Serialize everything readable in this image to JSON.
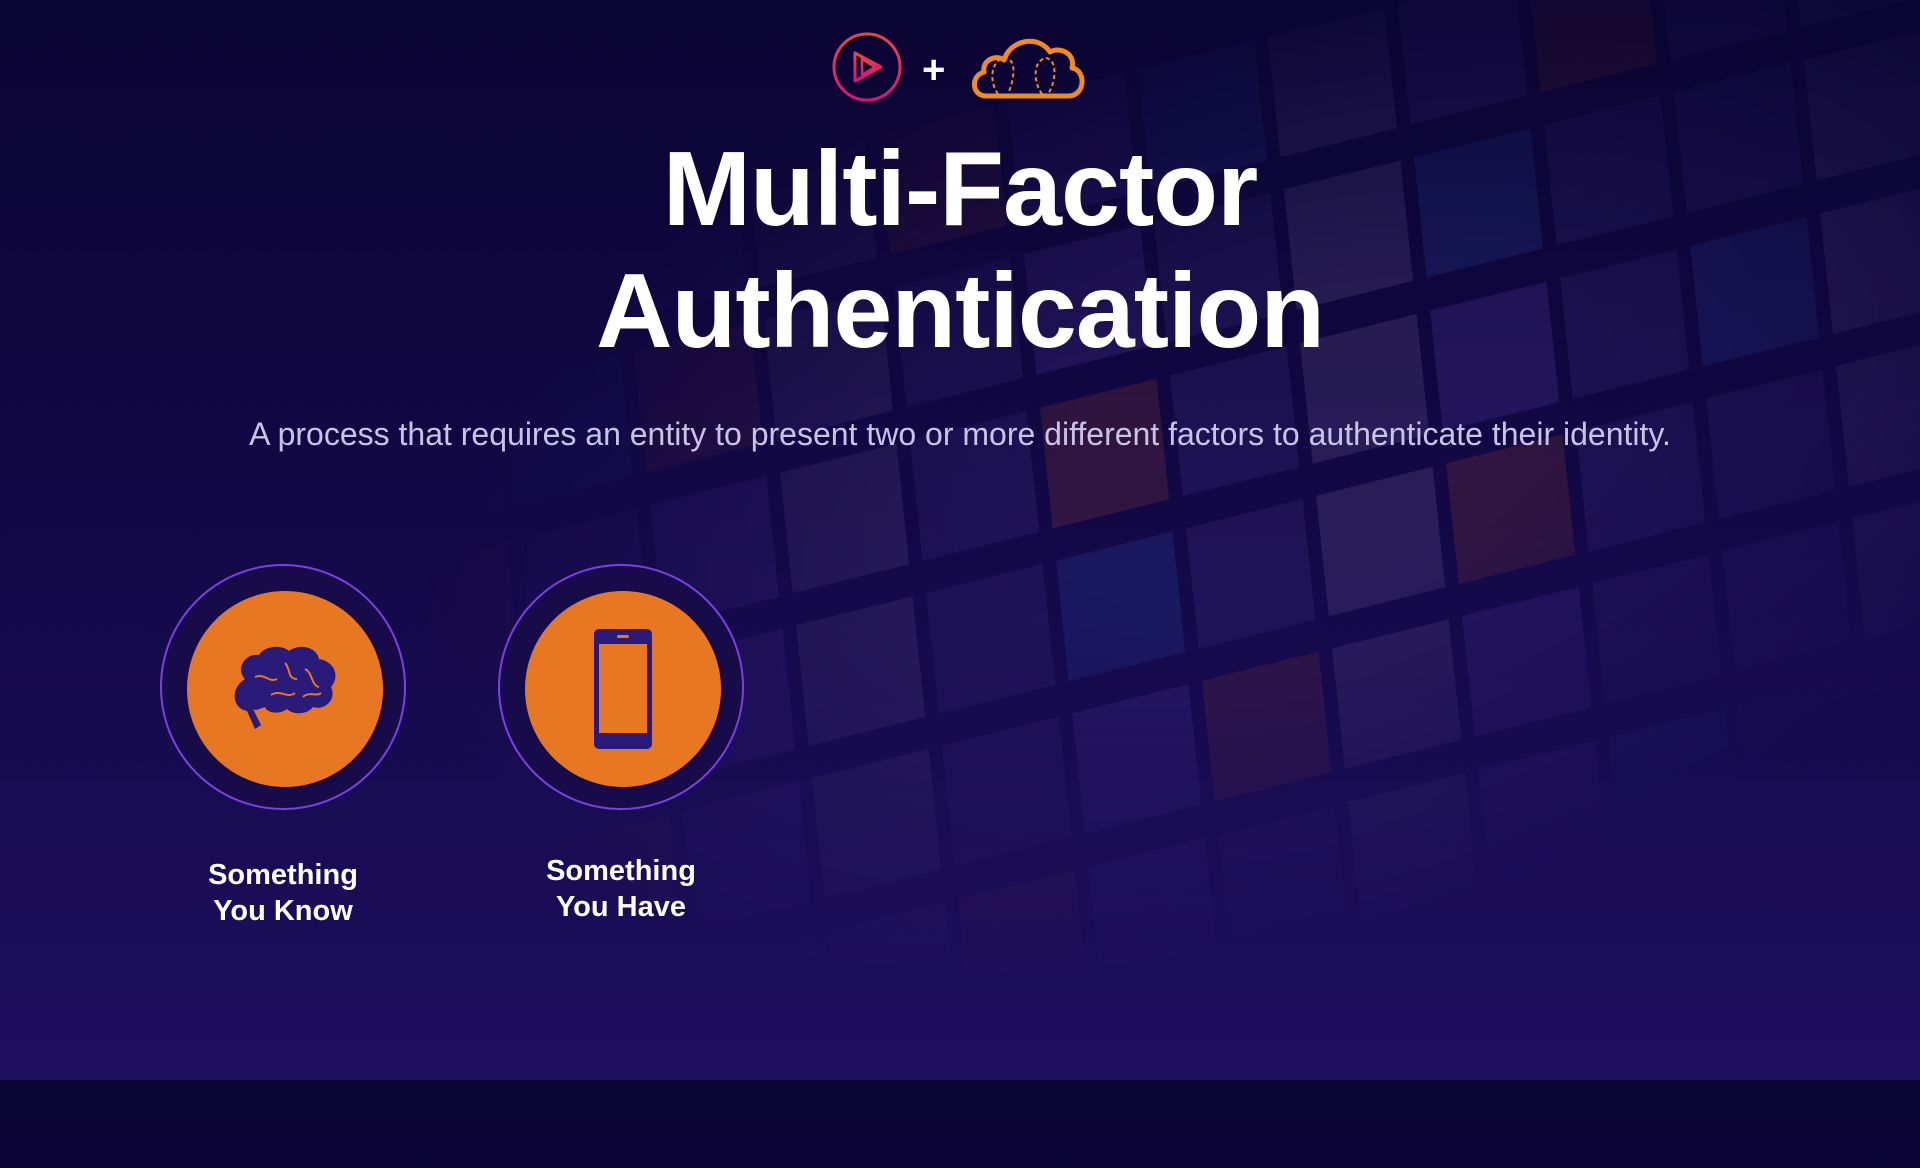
{
  "title": {
    "line1": "Multi-Factor",
    "line2": "Authentication"
  },
  "subtitle": "A process that requires an entity to present two or more different factors to authenticate their identity.",
  "logos": {
    "plus": "+",
    "left": "play-logo-icon",
    "right": "cloud-logo-icon"
  },
  "factors": [
    {
      "icon": "brain-icon",
      "line1": "Something",
      "line2": "You Know"
    },
    {
      "icon": "smartphone-icon",
      "line1": "Something",
      "line2": "You Have"
    }
  ],
  "colors": {
    "accent": "#e87722",
    "ring": "#7a3fe0",
    "icon": "#2a1a7a",
    "pink": "#e0245e"
  }
}
